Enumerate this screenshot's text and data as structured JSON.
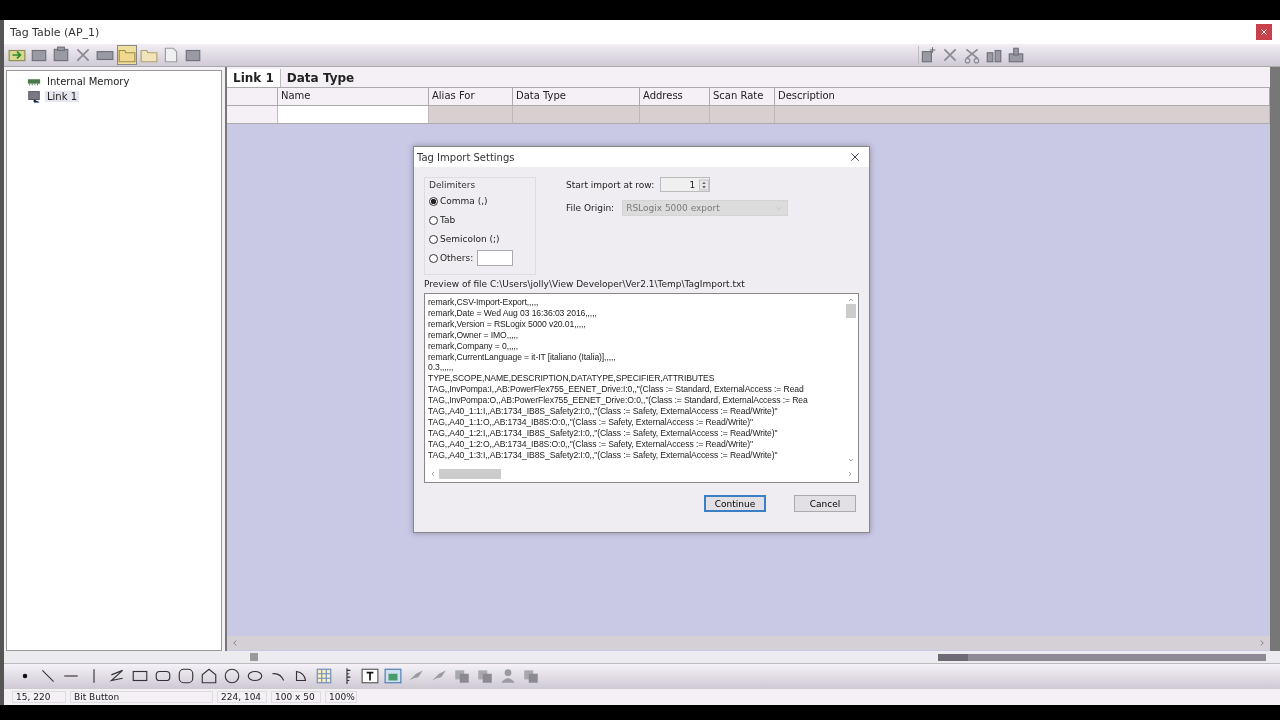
{
  "window": {
    "title": "Tag Table (AP_1)"
  },
  "tree": {
    "items": [
      {
        "label": "Internal Memory",
        "selected": false
      },
      {
        "label": "Link 1",
        "selected": true
      }
    ]
  },
  "tabs": [
    {
      "label": "Link 1",
      "selected": true
    },
    {
      "label": "Data Type",
      "selected": false
    }
  ],
  "table": {
    "columns": [
      "Name",
      "Alias For",
      "Data Type",
      "Address",
      "Scan Rate",
      "Description"
    ]
  },
  "dialog": {
    "title": "Tag Import Settings",
    "delimiters": {
      "label": "Delimiters",
      "options": [
        {
          "label": "Comma (,)",
          "selected": true
        },
        {
          "label": "Tab",
          "selected": false
        },
        {
          "label": "Semicolon (;)",
          "selected": false
        },
        {
          "label": "Others:",
          "selected": false
        }
      ]
    },
    "start_row": {
      "label": "Start import at row:",
      "value": "1"
    },
    "file_origin": {
      "label": "File Origin:",
      "value": "RSLogix 5000 export",
      "disabled": true
    },
    "preview_label": "Preview of file C:\\Users\\jolly\\View Developer\\Ver2.1\\Temp\\TagImport.txt",
    "preview_lines": [
      "remark,CSV-Import-Export,,,,,",
      "remark,Date = Wed Aug 03 16:36:03 2016,,,,,",
      "remark,Version = RSLogix 5000 v20.01,,,,,",
      "remark,Owner = IMO,,,,,",
      "remark,Company = 0,,,,,",
      "remark,CurrentLanguage = it-IT [italiano (Italia)],,,,,",
      "0.3,,,,,,",
      "TYPE,SCOPE,NAME,DESCRIPTION,DATATYPE,SPECIFIER,ATTRIBUTES",
      "TAG,,InvPompa:I,,AB:PowerFlex755_EENET_Drive:I:0,,\"(Class := Standard, ExternalAccess := Read",
      "TAG,,InvPompa:O,,AB:PowerFlex755_EENET_Drive:O:0,,\"(Class := Standard, ExternalAccess := Rea",
      "TAG,,A40_1:1:I,,AB:1734_IB8S_Safety2:I:0,,\"(Class := Safety, ExternalAccess := Read/Write)\"",
      "TAG,,A40_1:1:O,,AB:1734_IB8S:O:0,,\"(Class := Safety, ExternalAccess := Read/Write)\"",
      "TAG,,A40_1:2:I,,AB:1734_IB8S_Safety2:I:0,,\"(Class := Safety, ExternalAccess := Read/Write)\"",
      "TAG,,A40_1:2:O,,AB:1734_IB8S:O:0,,\"(Class := Safety, ExternalAccess := Read/Write)\"",
      "TAG,,A40_1:3:I,,AB:1734_IB8S_Safety2:I:0,,\"(Class := Safety, ExternalAccess := Read/Write)\""
    ],
    "buttons": [
      {
        "label": "Continue",
        "kind": "default"
      },
      {
        "label": "Cancel",
        "kind": "normal"
      }
    ]
  },
  "status_bar": [
    "15, 220",
    "Bit Button",
    "224, 104",
    "100 x 50",
    "100%"
  ]
}
